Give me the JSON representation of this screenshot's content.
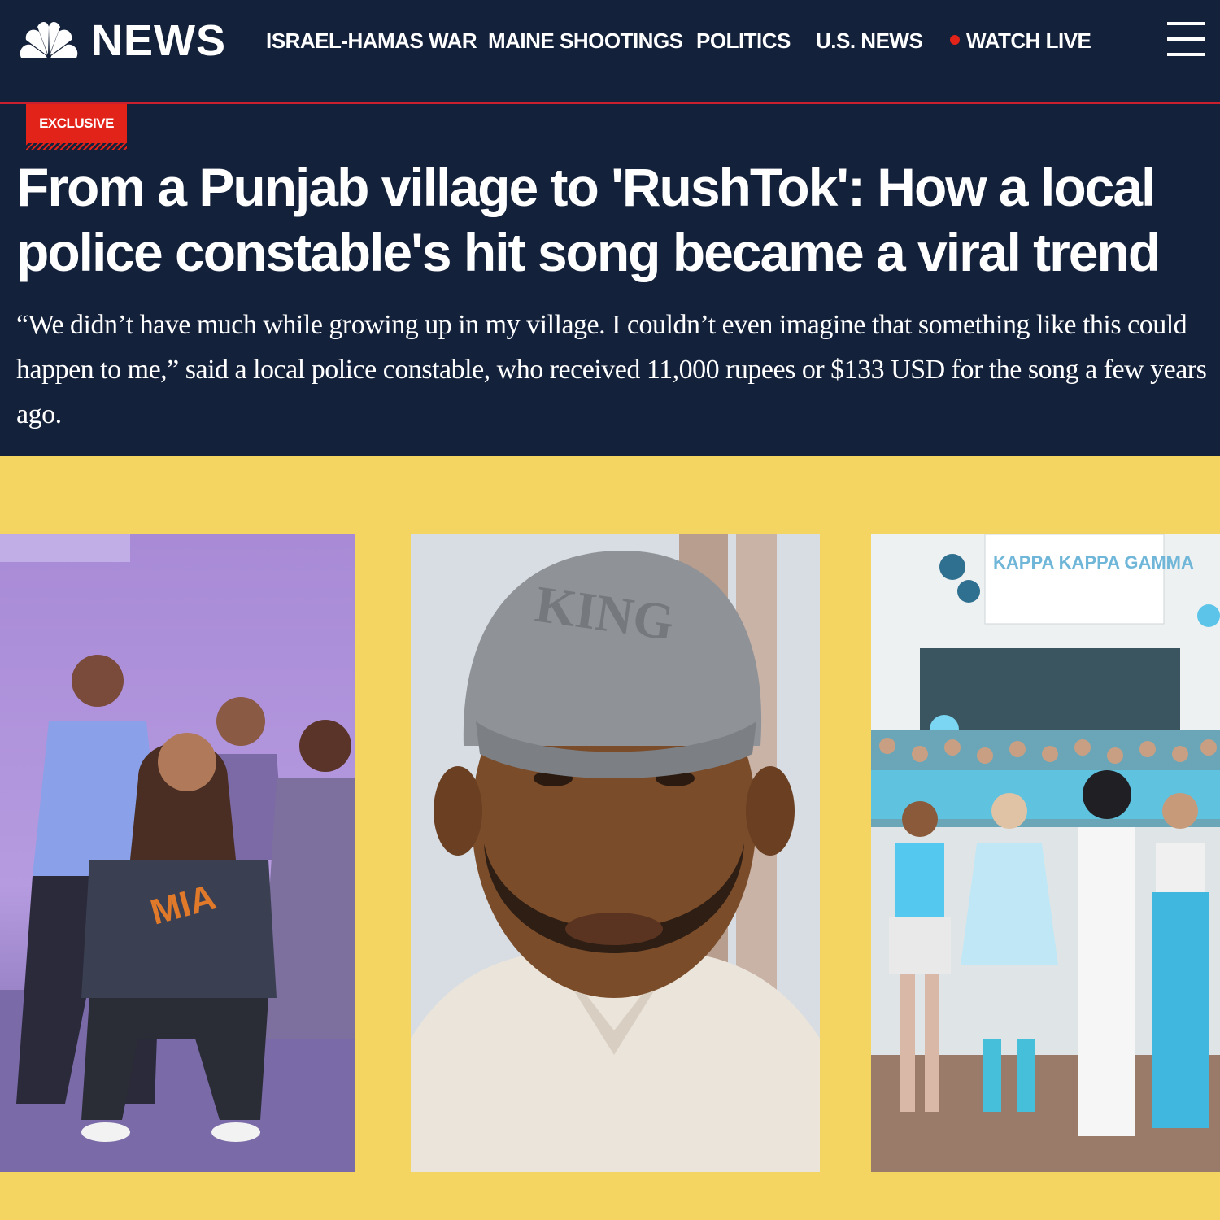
{
  "brand": {
    "logo": "nbc-peacock-icon",
    "name": "NEWS"
  },
  "nav": {
    "items": [
      {
        "label": "ISRAEL-HAMAS WAR"
      },
      {
        "label": "MAINE SHOOTINGS"
      },
      {
        "label": "POLITICS"
      },
      {
        "label": "U.S. NEWS"
      },
      {
        "label": "WATCH LIVE",
        "live_indicator": "red-dot-icon"
      }
    ],
    "menu_icon": "hamburger-menu-icon"
  },
  "article": {
    "badge": "EXCLUSIVE",
    "headline": "From a Punjab village to 'RushTok': How a local police constable's hit song became a viral trend",
    "dek": "“We didn’t have much while growing up in my village. I couldn’t even imagine that something like this could happen to me,” said a local police constable, who received 11,000 rupees or $133 USD for the song a few years ago."
  },
  "hero": {
    "cap_text": "KING",
    "banner_text": "KAPPA KAPPA GAMMA"
  },
  "colors": {
    "header_bg": "#14213a",
    "accent_red": "#e2231a",
    "hero_bg": "#f4d562"
  }
}
